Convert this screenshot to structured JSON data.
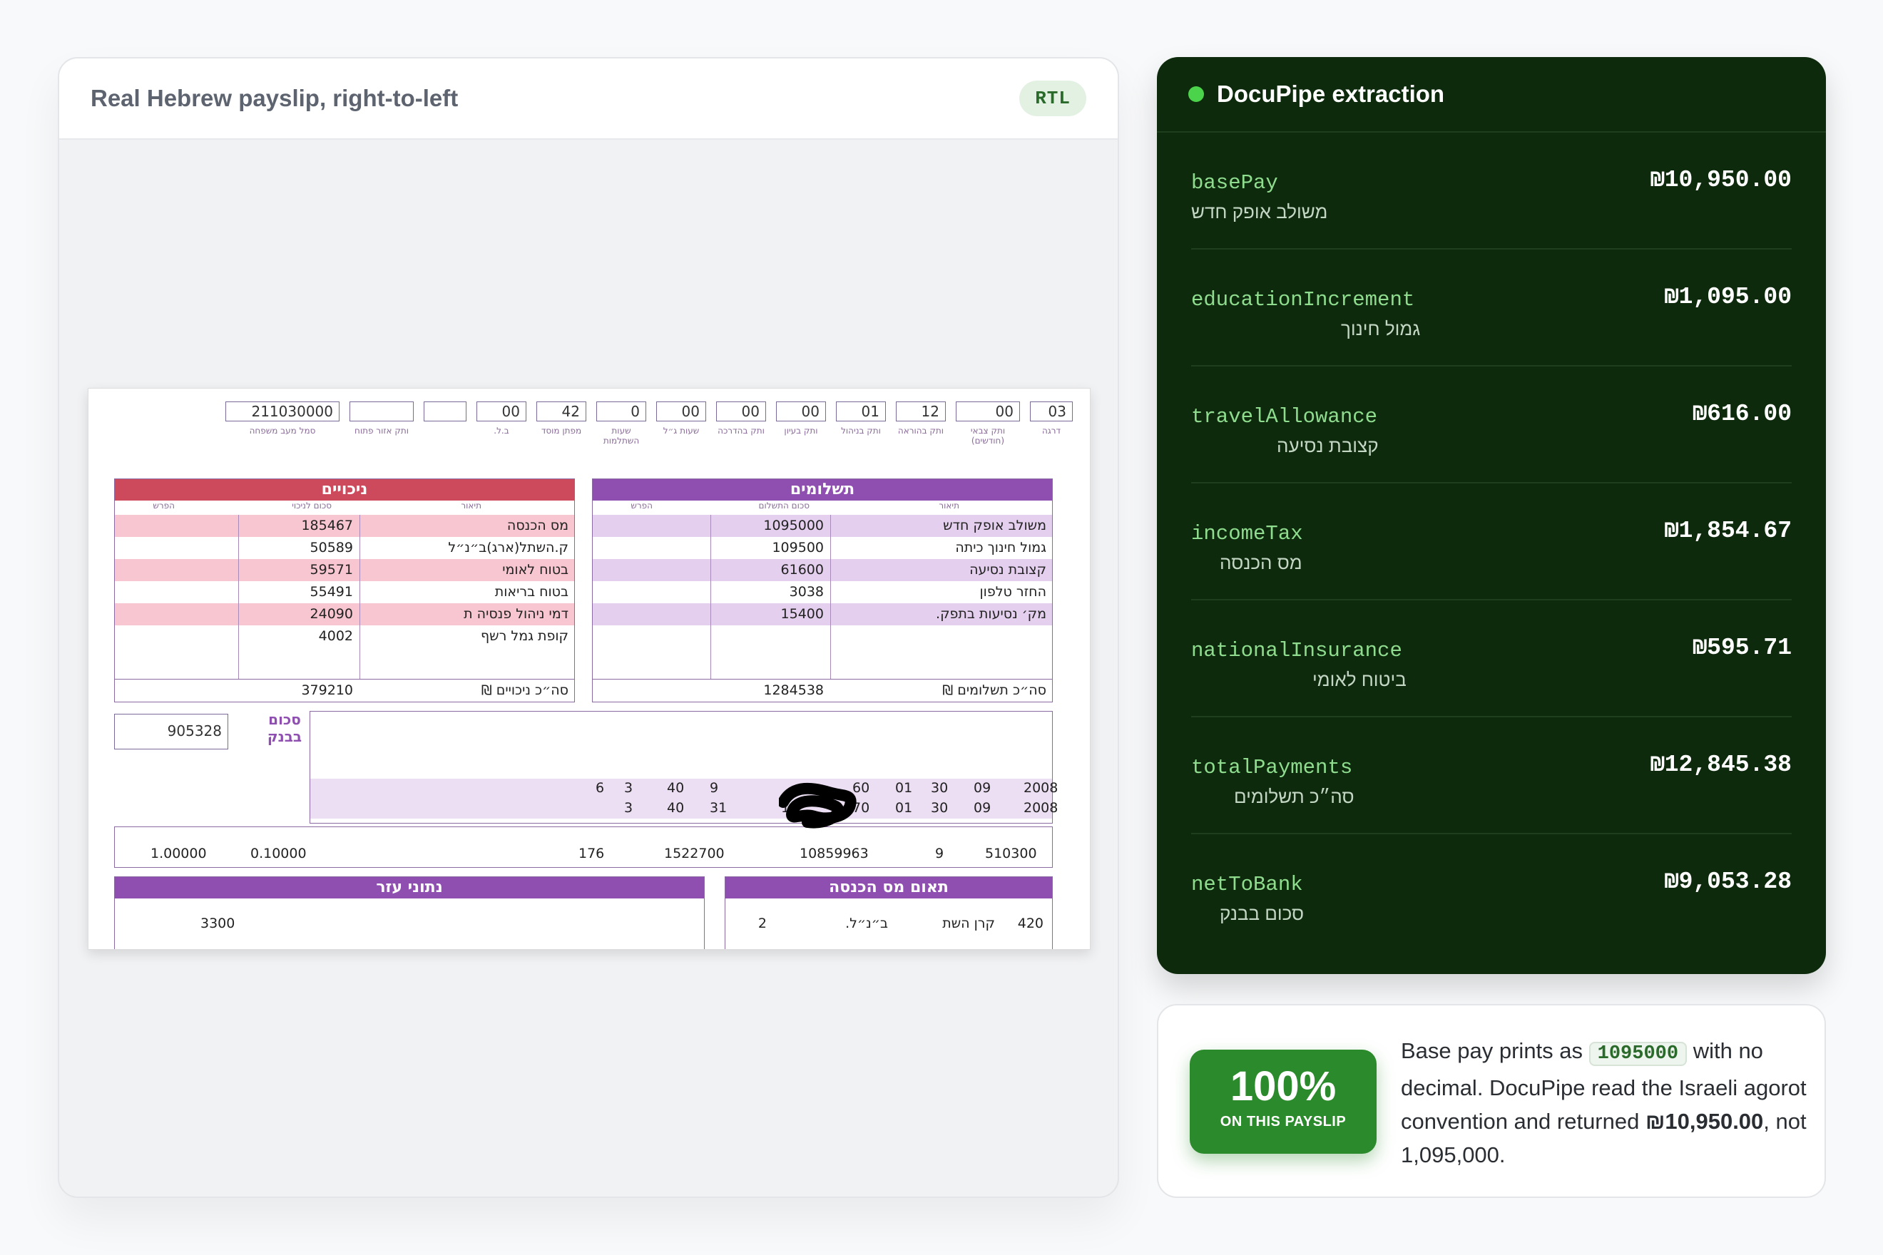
{
  "left": {
    "title": "Real Hebrew payslip, right-to-left",
    "badge": "RTL"
  },
  "slip": {
    "top_boxes": [
      "03",
      "00",
      "12",
      "01",
      "00",
      "00",
      "00",
      "0",
      "42",
      "00",
      "",
      "",
      "211030000"
    ],
    "top_labels": [
      "דרגה",
      "ותק צבאי (חודשים)",
      "ותק בהוראה",
      "ותק בניהול",
      "ותק בעיון",
      "ותק בהדרכה",
      "שעות ג״ל",
      "שעות השתלמות",
      "מפתן מוסד",
      "ב.ל.",
      "",
      "ותק אזור פתוח",
      "סמל מעב משפחה"
    ],
    "payments": {
      "head": "תשלומים",
      "col_desc": "תיאור",
      "col_sum": "סכום התשלום",
      "col_diff": "הפרש",
      "rows": [
        {
          "desc": "משולב אופק חדש",
          "sum": "1095000"
        },
        {
          "desc": "גמול חינוך כיתה",
          "sum": "109500"
        },
        {
          "desc": "קצובת נסיעה",
          "sum": "61600"
        },
        {
          "desc": "החזר טלפון",
          "sum": "3038"
        },
        {
          "desc": "מק׳ נסיעות בתפק.",
          "sum": "15400"
        }
      ],
      "total_label": "סה״כ תשלומים ₪",
      "total": "1284538"
    },
    "deductions": {
      "head": "ניכויים",
      "col_desc": "תיאור",
      "col_sum": "סכום לניכוי",
      "col_diff": "הפרש",
      "rows": [
        {
          "desc": "מס הכנסה",
          "sum": "185467"
        },
        {
          "desc": "ק.השתל(ארג)ב״נ״ל",
          "sum": "50589"
        },
        {
          "desc": "בטוח לאומי",
          "sum": "59571"
        },
        {
          "desc": "בטוח בריאות",
          "sum": "55491"
        },
        {
          "desc": "דמי ניהול פנסיה ת",
          "sum": "24090"
        },
        {
          "desc": "קופת גמל רשף",
          "sum": "4002"
        }
      ],
      "total_label": "סה״כ ניכויים ₪",
      "total": "379210"
    },
    "bank_label": "סכום בבנק",
    "bank_value": "905328",
    "grid_rows": [
      [
        "2008",
        "09",
        "30",
        "01",
        "60",
        "",
        "9",
        "40",
        "3",
        "6"
      ],
      [
        "2008",
        "09",
        "30",
        "01",
        "70",
        "15",
        "31",
        "40",
        "3",
        ""
      ]
    ],
    "summary_values": [
      "510300",
      "9",
      "10859963",
      "1522700",
      "176",
      "",
      "",
      "",
      "0.10000",
      "1.00000"
    ],
    "aux_head": "נתוני עזר",
    "aux_value": "3300",
    "tax_head": "תאום מס הכנסה",
    "tax_row": [
      "420",
      "קרן השת",
      "ב״נ״ל.",
      "2"
    ]
  },
  "extraction": {
    "title": "DocuPipe extraction",
    "fields": [
      {
        "key": "basePay",
        "hebrew": "משולב אופק חדש",
        "value": "₪10,950.00"
      },
      {
        "key": "educationIncrement",
        "hebrew": "גמול חינוך",
        "value": "₪1,095.00"
      },
      {
        "key": "travelAllowance",
        "hebrew": "קצובת נסיעה",
        "value": "₪616.00"
      },
      {
        "key": "incomeTax",
        "hebrew": "מס הכנסה",
        "value": "₪1,854.67"
      },
      {
        "key": "nationalInsurance",
        "hebrew": "ביטוח לאומי",
        "value": "₪595.71"
      },
      {
        "key": "totalPayments",
        "hebrew": "סה״כ תשלומים",
        "value": "₪12,845.38"
      },
      {
        "key": "netToBank",
        "hebrew": "סכום בבנק",
        "value": "₪9,053.28"
      }
    ]
  },
  "note": {
    "stat": "100%",
    "stat_label": "ON THIS PAYSLIP",
    "text_1": "Base pay prints as",
    "code": "1095000",
    "text_2": "with no decimal. DocuPipe read the Israeli agorot convention and returned",
    "strong": "₪10,950.00",
    "text_3": ", not 1,095,000."
  },
  "colors": {
    "accent_green": "#2b8a2b",
    "panel_bg": "#0d2a0d",
    "key_green": "#8fdc8f",
    "payments_purple": "#8e4fb0",
    "deductions_red": "#cc4a5c"
  }
}
